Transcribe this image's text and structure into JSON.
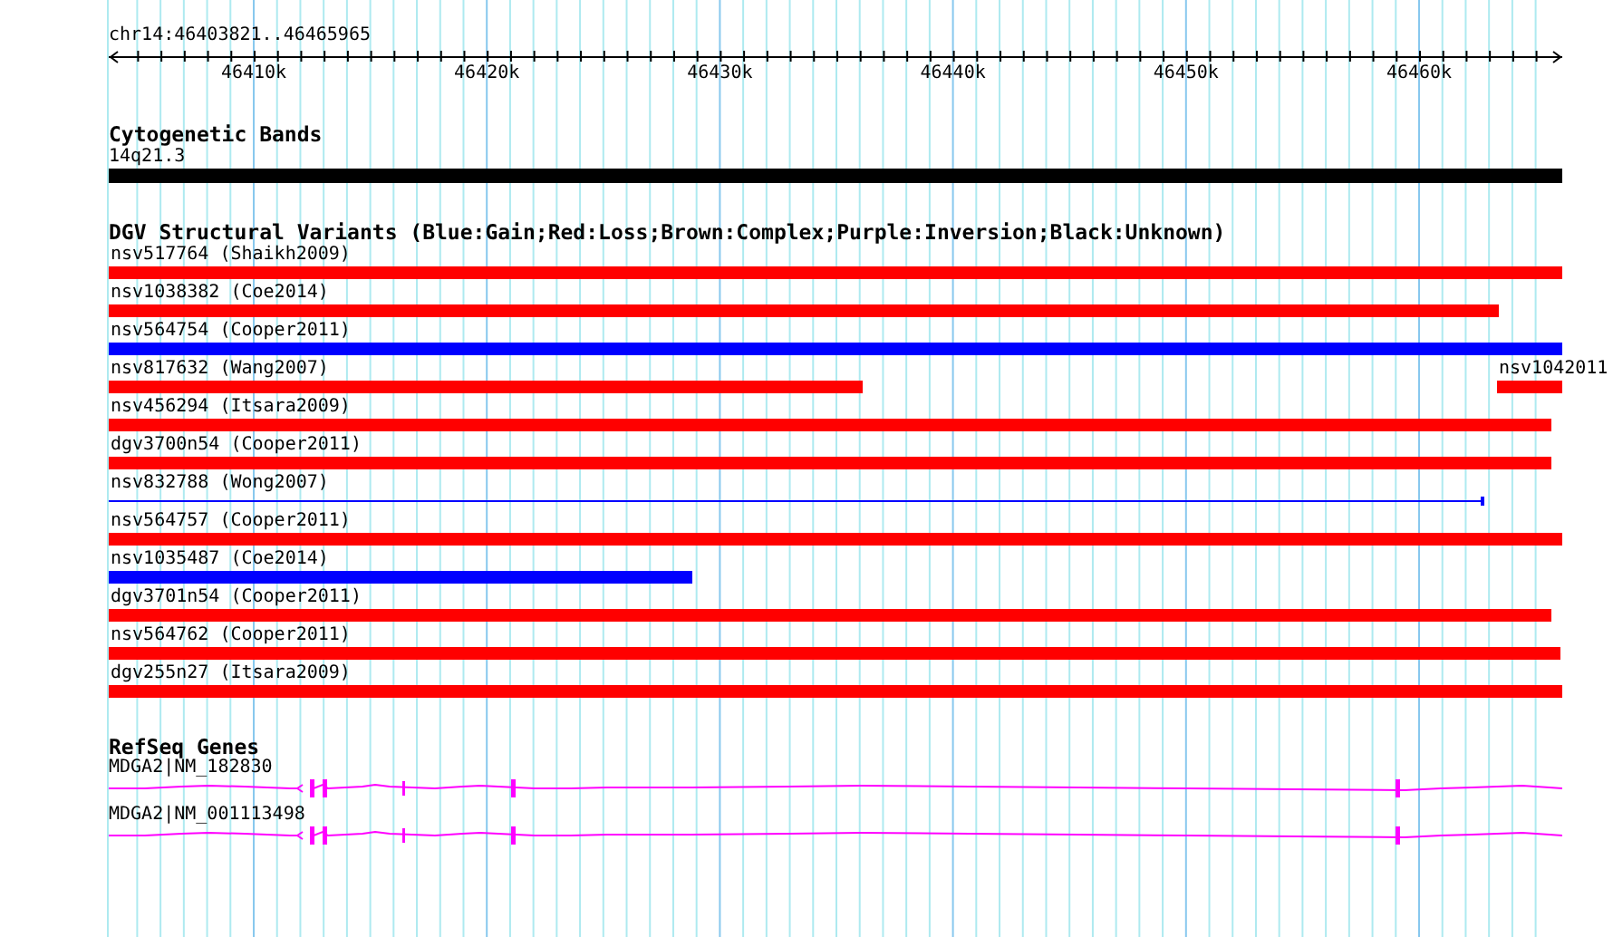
{
  "ruler": {
    "title": "chr14:46403821..46465965",
    "ticks": [
      "46410k",
      "46420k",
      "46430k",
      "46440k",
      "46450k",
      "46460k"
    ]
  },
  "cytogenetic": {
    "title": "Cytogenetic Bands",
    "band": "14q21.3"
  },
  "dgv": {
    "title": "DGV Structural Variants (Blue:Gain;Red:Loss;Brown:Complex;Purple:Inversion;Black:Unknown)",
    "rows": [
      {
        "features": [
          {
            "label": "nsv517764 (Shaikh2009)",
            "color": "#ff0000",
            "kind": "bar"
          }
        ]
      },
      {
        "features": [
          {
            "label": "nsv1038382 (Coe2014)",
            "color": "#ff0000",
            "kind": "bar"
          }
        ]
      },
      {
        "features": [
          {
            "label": "nsv564754 (Cooper2011)",
            "color": "#0000ff",
            "kind": "bar"
          }
        ]
      },
      {
        "features": [
          {
            "label": "nsv817632 (Wang2007)",
            "color": "#ff0000",
            "kind": "bar"
          },
          {
            "label": "nsv1042011",
            "color": "#ff0000",
            "kind": "bar"
          }
        ]
      },
      {
        "features": [
          {
            "label": "nsv456294 (Itsara2009)",
            "color": "#ff0000",
            "kind": "bar"
          }
        ]
      },
      {
        "features": [
          {
            "label": "dgv3700n54 (Cooper2011)",
            "color": "#ff0000",
            "kind": "bar"
          }
        ]
      },
      {
        "features": [
          {
            "label": "nsv832788 (Wong2007)",
            "color": "#0000ff",
            "kind": "line"
          }
        ]
      },
      {
        "features": [
          {
            "label": "nsv564757 (Cooper2011)",
            "color": "#ff0000",
            "kind": "bar"
          }
        ]
      },
      {
        "features": [
          {
            "label": "nsv1035487 (Coe2014)",
            "color": "#0000ff",
            "kind": "bar"
          }
        ]
      },
      {
        "features": [
          {
            "label": "dgv3701n54 (Cooper2011)",
            "color": "#ff0000",
            "kind": "bar"
          }
        ]
      },
      {
        "features": [
          {
            "label": "nsv564762 (Cooper2011)",
            "color": "#ff0000",
            "kind": "bar"
          }
        ]
      },
      {
        "features": [
          {
            "label": "dgv255n27 (Itsara2009)",
            "color": "#ff0000",
            "kind": "bar"
          }
        ]
      }
    ]
  },
  "refseq": {
    "title": "RefSeq Genes",
    "genes": [
      {
        "label": "MDGA2|NM_182830"
      },
      {
        "label": "MDGA2|NM_001113498"
      }
    ]
  }
}
